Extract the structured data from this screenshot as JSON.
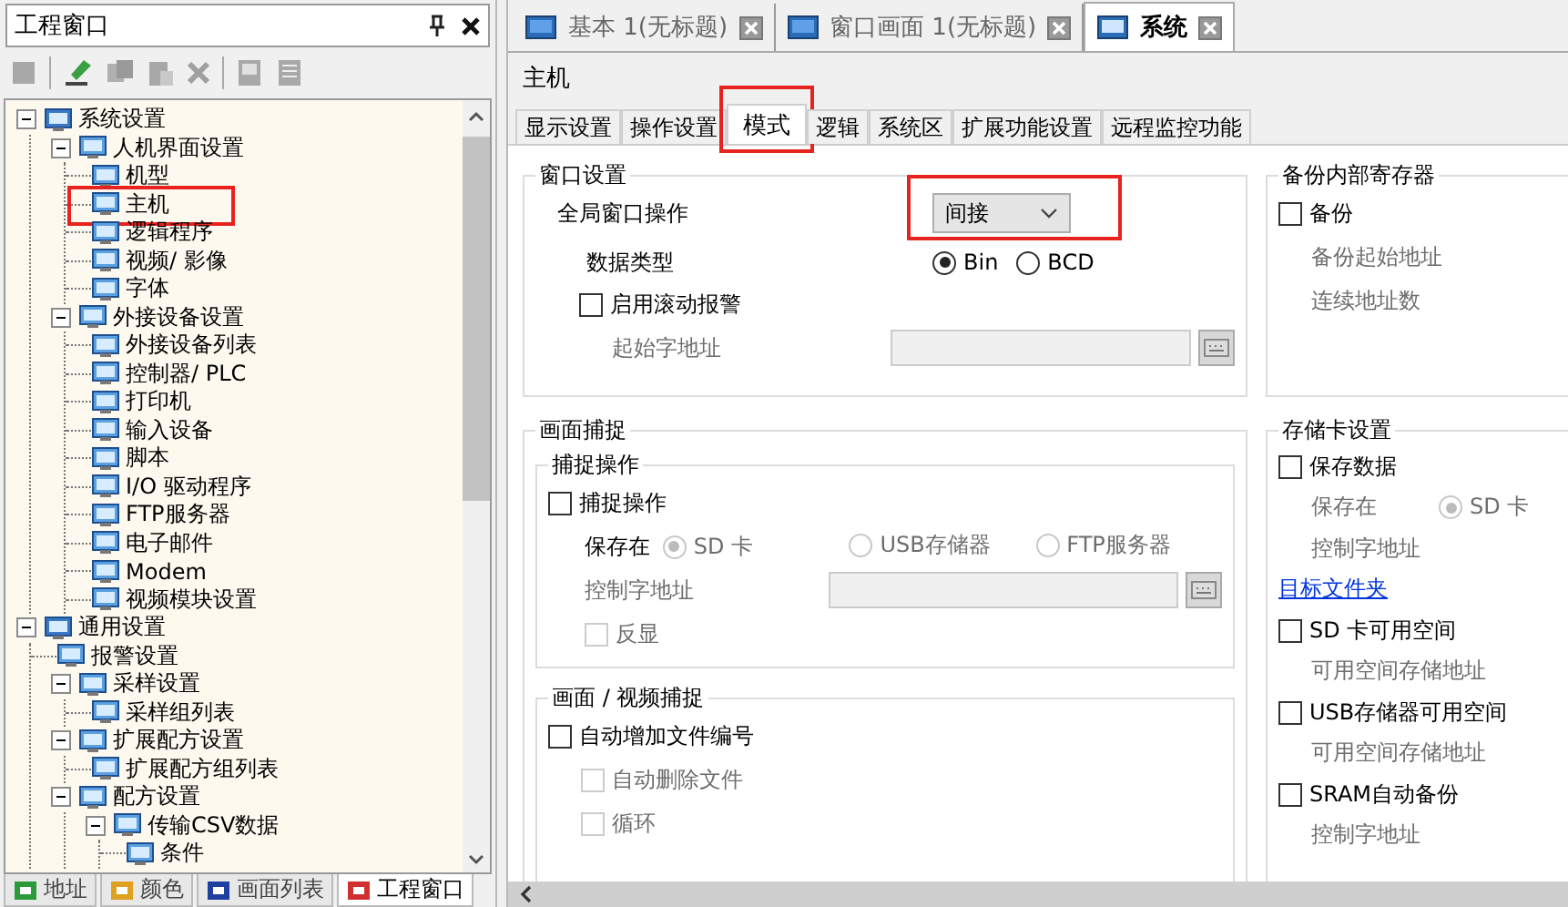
{
  "project_window": {
    "title": "工程窗口",
    "tree": [
      {
        "label": "系统设置",
        "expanded": true,
        "highlighted": false,
        "children": [
          {
            "label": "人机界面设置",
            "expanded": true,
            "highlighted": false,
            "children": [
              {
                "label": "机型",
                "highlighted": false
              },
              {
                "label": "主机",
                "highlighted": true
              },
              {
                "label": "逻辑程序",
                "highlighted": false
              },
              {
                "label": "视频/ 影像",
                "highlighted": false
              },
              {
                "label": "字体",
                "highlighted": false
              }
            ]
          },
          {
            "label": "外接设备设置",
            "expanded": true,
            "highlighted": false,
            "children": [
              {
                "label": "外接设备列表",
                "highlighted": false
              },
              {
                "label": "控制器/ PLC",
                "highlighted": false
              },
              {
                "label": "打印机",
                "highlighted": false
              },
              {
                "label": "输入设备",
                "highlighted": false
              },
              {
                "label": "脚本",
                "highlighted": false
              },
              {
                "label": "I/O 驱动程序",
                "highlighted": false
              },
              {
                "label": "FTP服务器",
                "highlighted": false
              },
              {
                "label": "电子邮件",
                "highlighted": false
              },
              {
                "label": "Modem",
                "highlighted": false
              },
              {
                "label": "视频模块设置",
                "highlighted": false
              }
            ]
          }
        ]
      },
      {
        "label": "通用设置",
        "expanded": true,
        "highlighted": false,
        "children": [
          {
            "label": "报警设置",
            "highlighted": false
          },
          {
            "label": "采样设置",
            "expanded": true,
            "highlighted": false,
            "children": [
              {
                "label": "采样组列表",
                "highlighted": false
              }
            ]
          },
          {
            "label": "扩展配方设置",
            "expanded": true,
            "highlighted": false,
            "children": [
              {
                "label": "扩展配方组列表",
                "highlighted": false
              }
            ]
          },
          {
            "label": "配方设置",
            "expanded": true,
            "highlighted": false,
            "children": [
              {
                "label": "传输CSV数据",
                "expanded": true,
                "highlighted": false,
                "children": [
                  {
                    "label": "条件",
                    "highlighted": false
                  }
                ]
              }
            ]
          }
        ]
      }
    ],
    "bottom_tabs": [
      {
        "label": "地址",
        "selected": false
      },
      {
        "label": "颜色",
        "selected": false
      },
      {
        "label": "画面列表",
        "selected": false
      },
      {
        "label": "工程窗口",
        "selected": true
      }
    ]
  },
  "doc_tabs": [
    {
      "label": "基本 1(无标题)",
      "selected": false
    },
    {
      "label": "窗口画面 1(无标题)",
      "selected": false
    },
    {
      "label": "系统",
      "selected": true
    }
  ],
  "page_title": "主机",
  "sub_tabs": [
    {
      "label": "显示设置",
      "selected": false,
      "highlighted": false
    },
    {
      "label": "操作设置",
      "selected": false,
      "highlighted": false
    },
    {
      "label": "模式",
      "selected": true,
      "highlighted": true
    },
    {
      "label": "逻辑",
      "selected": false,
      "highlighted": false
    },
    {
      "label": "系统区",
      "selected": false,
      "highlighted": false
    },
    {
      "label": "扩展功能设置",
      "selected": false,
      "highlighted": false
    },
    {
      "label": "远程监控功能",
      "selected": false,
      "highlighted": false
    }
  ],
  "window_settings": {
    "title": "窗口设置",
    "global_label": "全局窗口操作",
    "global_value": "间接",
    "global_highlighted": true,
    "data_type_label": "数据类型",
    "data_types": [
      {
        "label": "Bin",
        "selected": true
      },
      {
        "label": "BCD",
        "selected": false
      }
    ],
    "scroll_alarm": {
      "label": "启用滚动报警",
      "checked": false
    },
    "start_address_label": "起始字地址"
  },
  "capture": {
    "title": "画面捕捉",
    "operation": {
      "title": "捕捉操作",
      "enable": {
        "label": "捕捉操作",
        "checked": false,
        "disabled": false
      },
      "save_label": "保存在",
      "save_targets": [
        {
          "label": "SD 卡",
          "selected": true,
          "disabled": true
        },
        {
          "label": "USB存储器",
          "selected": false,
          "disabled": true
        },
        {
          "label": "FTP服务器",
          "selected": false,
          "disabled": true
        }
      ],
      "control_label": "控制字地址",
      "invert": {
        "label": "反显",
        "checked": false,
        "disabled": true
      }
    },
    "video": {
      "title": "画面 / 视频捕捉",
      "auto_number": {
        "label": "自动增加文件编号",
        "checked": false,
        "disabled": false
      },
      "auto_delete": {
        "label": "自动删除文件",
        "checked": false,
        "disabled": true
      },
      "cycle": {
        "label": "循环",
        "checked": false,
        "disabled": true
      }
    }
  },
  "backup": {
    "title": "备份内部寄存器",
    "enable": {
      "label": "备份",
      "checked": false,
      "disabled": false
    },
    "start_label": "备份起始地址",
    "count_label": "连续地址数"
  },
  "storage": {
    "title": "存储卡设置",
    "save_data": {
      "label": "保存数据",
      "checked": false,
      "disabled": false
    },
    "save_label": "保存在",
    "save_target": {
      "label": "SD 卡",
      "selected": true,
      "disabled": true
    },
    "control_label": "控制字地址",
    "folder_link": "目标文件夹",
    "options": [
      {
        "label": "SD 卡可用空间",
        "checked": false,
        "disabled": false,
        "address_label": "可用空间存储地址"
      },
      {
        "label": "USB存储器可用空间",
        "checked": false,
        "disabled": false,
        "address_label": "可用空间存储地址"
      },
      {
        "label": "SRAM自动备份",
        "checked": false,
        "disabled": false,
        "address_label": "控制字地址"
      }
    ]
  }
}
